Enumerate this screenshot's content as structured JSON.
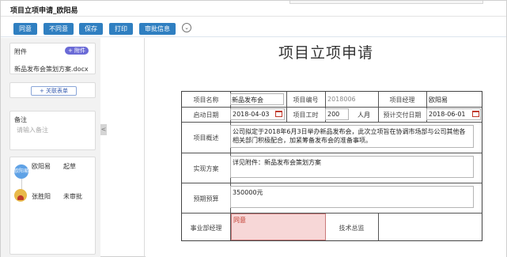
{
  "window": {
    "title": "项目立项申请_欧阳易"
  },
  "toolbar": {
    "buttons": [
      "同意",
      "不同意",
      "保存",
      "打印",
      "审批信息"
    ],
    "more_icon": "chevron-double-down-icon",
    "accent": "#2f7fc1"
  },
  "sidebar": {
    "attachment_label": "附件",
    "add_attachment": "+ 附件",
    "attachment_file": "新品发布会策划方案.docx",
    "relate_form": "+ 关联表单",
    "remark_label": "备注",
    "remark_placeholder": "请输入备注",
    "flow": [
      {
        "avatar": "欧阳易",
        "name": "欧阳易",
        "status": "起草"
      },
      {
        "name": "张胜阳",
        "status": "未审批"
      }
    ],
    "collapse_icon": "<"
  },
  "form": {
    "title": "项目立项申请",
    "project_name_label": "项目名称",
    "project_name": "新品发布会",
    "project_no_label": "项目编号",
    "project_no": "2018006",
    "manager_label": "项目经理",
    "manager": "欧阳易",
    "start_date_label": "启动日期",
    "start_date": "2018-04-03",
    "workdays_label": "项目工时",
    "workdays": "200",
    "workdays_unit": "人月",
    "delivery_label": "预计交付日期",
    "delivery_date": "2018-06-01",
    "overview_label": "项目概述",
    "overview_text": "公司拟定于2018年6月3日举办新品发布会，此次立项旨在协调市场部与公司其他各相关部门积极配合，加紧筹备发布会的准备事项。",
    "plan_label": "实现方案",
    "plan_text": "详见附件：新品发布会策划方案",
    "budget_label": "预期预算",
    "budget_text": "350000元",
    "dept_manager_label": "事业部经理",
    "dept_manager_opinion": "同意",
    "tech_director_label": "技术总监"
  },
  "colors": {
    "calendar_icon": "#c0392b",
    "opinion_bg": "#f7d7d7",
    "opinion_text": "#c0392b"
  }
}
